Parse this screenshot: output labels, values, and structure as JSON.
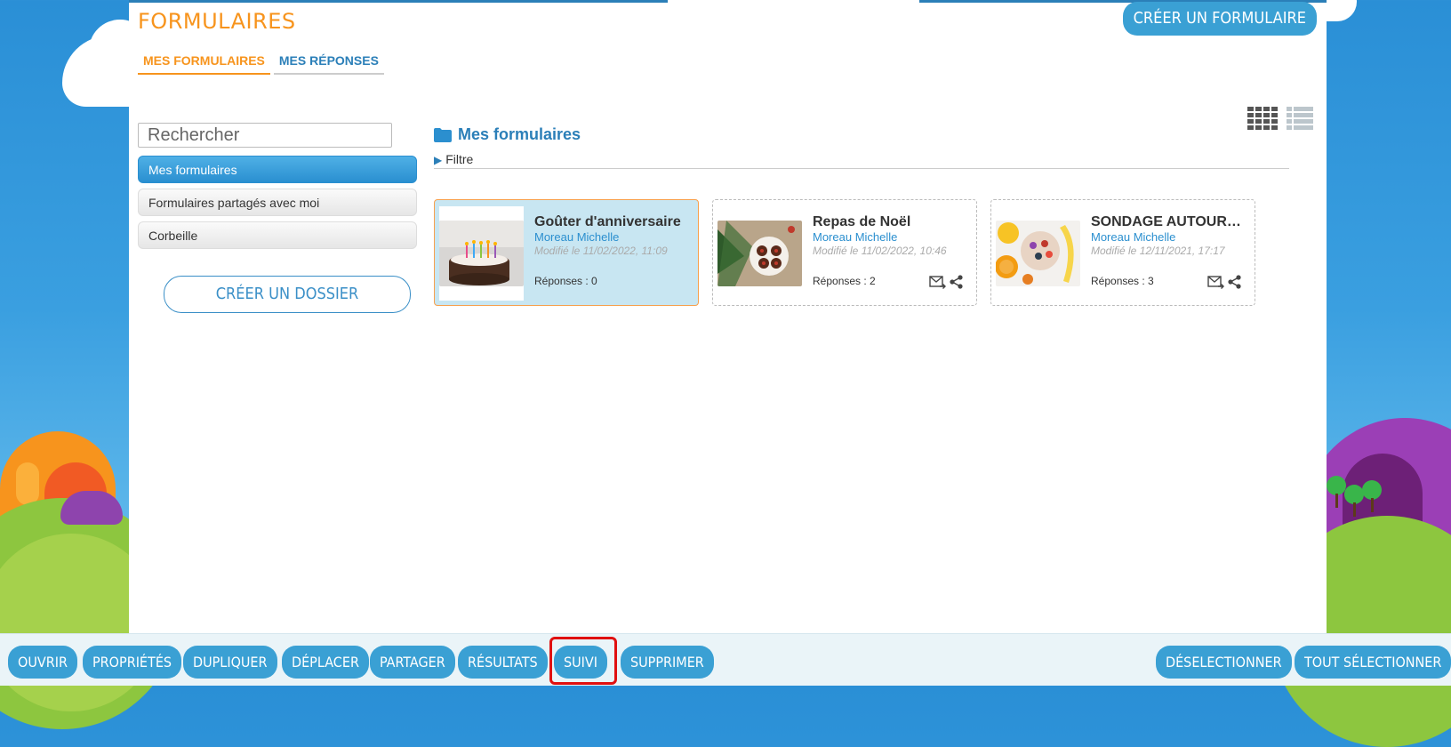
{
  "app": {
    "title": "FORMULAIRES",
    "create_form_label": "CRÉER UN FORMULAIRE"
  },
  "tabs": [
    {
      "label": "MES FORMULAIRES",
      "active": true
    },
    {
      "label": "MES RÉPONSES",
      "active": false
    }
  ],
  "sidebar": {
    "search_placeholder": "Rechercher",
    "items": [
      {
        "label": "Mes formulaires",
        "active": true
      },
      {
        "label": "Formulaires partagés avec moi",
        "active": false
      },
      {
        "label": "Corbeille",
        "active": false
      }
    ],
    "create_folder_label": "CRÉER UN DOSSIER"
  },
  "main": {
    "folder_title": "Mes formulaires",
    "filter_label": "Filtre",
    "cards": [
      {
        "title": "Goûter d'anniversaire",
        "author": "Moreau Michelle",
        "modified": "Modifié le 11/02/2022, 11:09",
        "responses": "Réponses : 0",
        "selected": true,
        "thumb": "birthday-cake-image",
        "show_actions": false
      },
      {
        "title": "Repas de Noël",
        "author": "Moreau Michelle",
        "modified": "Modifié le 11/02/2022, 10:46",
        "responses": "Réponses : 2",
        "selected": false,
        "thumb": "christmas-cookies-image",
        "show_actions": true
      },
      {
        "title": "SONDAGE AUTOUR…",
        "author": "Moreau Michelle",
        "modified": "Modifié le 12/11/2021, 17:17",
        "responses": "Réponses : 3",
        "selected": false,
        "thumb": "breakfast-fruit-image",
        "show_actions": true
      }
    ]
  },
  "toolbar": {
    "left": [
      "OUVRIR",
      "PROPRIÉTÉS",
      "DUPLIQUER",
      "DÉPLACER",
      "PARTAGER",
      "RÉSULTATS",
      "SUIVI",
      "SUPPRIMER"
    ],
    "right": [
      "DÉSELECTIONNER",
      "TOUT SÉLECTIONNER"
    ],
    "highlighted": "SUIVI"
  },
  "colors": {
    "accent": "#3aa0d4",
    "title_orange": "#f7941d",
    "link_blue": "#2b7fb8",
    "highlight_red": "#e01010"
  }
}
